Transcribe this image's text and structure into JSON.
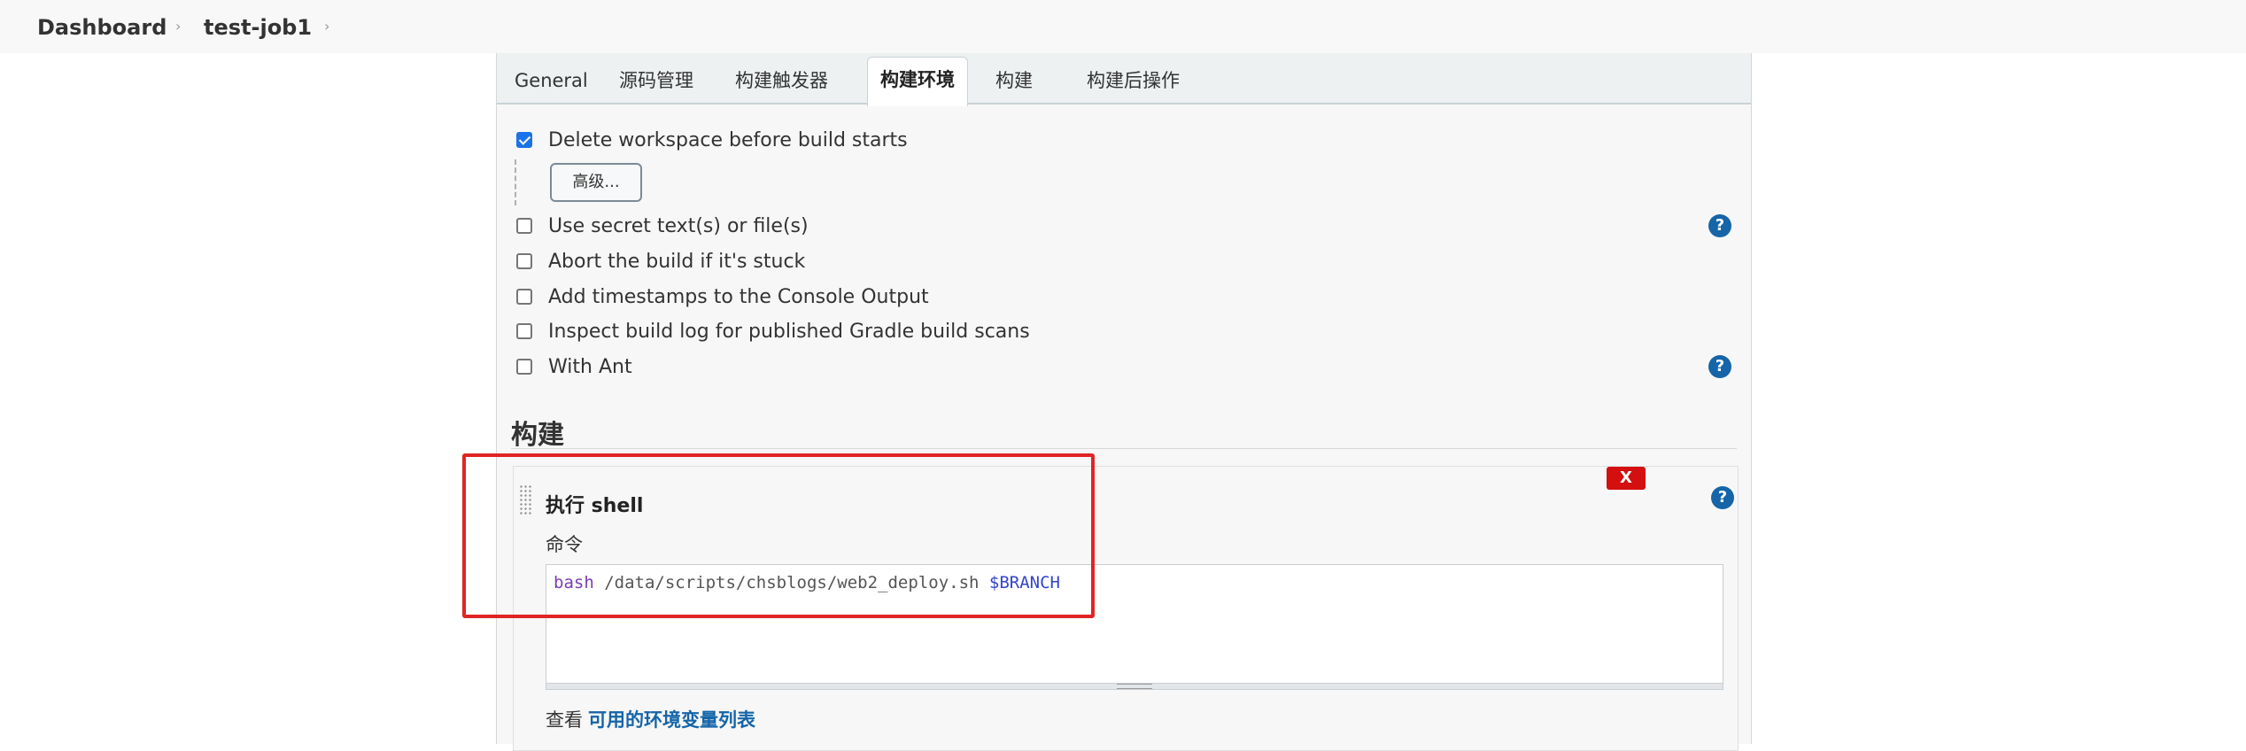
{
  "breadcrumb": {
    "items": [
      "Dashboard",
      "test-job1"
    ],
    "separator": "›"
  },
  "tabs": [
    "General",
    "源码管理",
    "构建触发器",
    "构建环境",
    "构建",
    "构建后操作"
  ],
  "active_tab": "构建环境",
  "build_env": {
    "options": [
      {
        "label": "Delete workspace before build starts",
        "checked": true
      },
      {
        "label": "Use secret text(s) or file(s)",
        "checked": false
      },
      {
        "label": "Abort the build if it's stuck",
        "checked": false
      },
      {
        "label": "Add timestamps to the Console Output",
        "checked": false
      },
      {
        "label": "Inspect build log for published Gradle build scans",
        "checked": false
      },
      {
        "label": "With Ant",
        "checked": false
      }
    ],
    "advanced_button": "高级..."
  },
  "build": {
    "section_title": "构建",
    "step": {
      "title": "执行 shell",
      "delete_label": "X",
      "command_label": "命令",
      "command": {
        "keyword": "bash",
        "path": " /data/scripts/chsblogs/web2_deploy.sh ",
        "variable": "$BRANCH"
      },
      "env_prefix": "查看",
      "env_link": "可用的环境变量列表"
    }
  },
  "help_label": "?",
  "colors": {
    "accent": "#1565a8",
    "annotation": "#e02424",
    "delete": "#d40f0f"
  }
}
